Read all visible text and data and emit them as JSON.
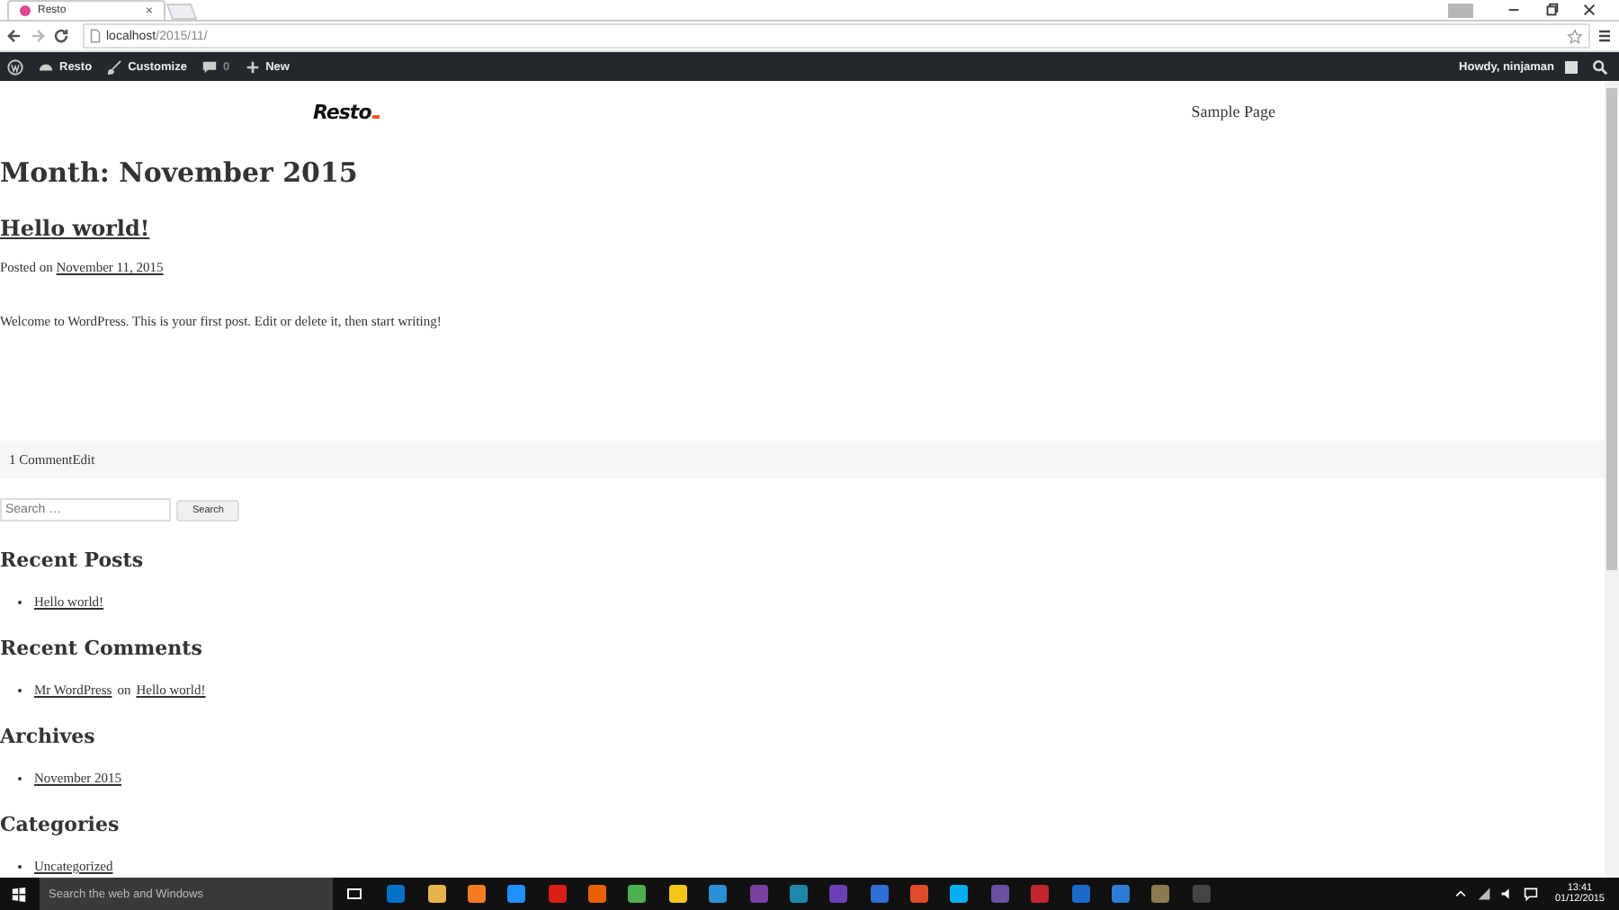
{
  "browser": {
    "tab_title": "Resto",
    "tab_close": "×",
    "url_host": "localhost",
    "url_path": "/2015/11/"
  },
  "admin_bar": {
    "site": "Resto",
    "customize": "Customize",
    "comments": "0",
    "new": "New",
    "greeting": "Howdy, ninjaman"
  },
  "site": {
    "logo": "Resto",
    "menu": [
      "Sample Page"
    ]
  },
  "archive_title": "Month: November 2015",
  "post": {
    "title": "Hello world!",
    "posted_on": "Posted on",
    "date": "November 11, 2015",
    "excerpt": "Welcome to WordPress. This is your first post. Edit or delete it, then start writing!",
    "comments_link": "1 Comment",
    "edit_link": "Edit"
  },
  "search": {
    "placeholder": "Search …",
    "button": "Search"
  },
  "widgets": [
    {
      "title": "Recent Posts",
      "items": [
        {
          "parts": [
            {
              "text": "Hello world!",
              "link": true
            }
          ]
        }
      ]
    },
    {
      "title": "Recent Comments",
      "items": [
        {
          "parts": [
            {
              "text": "Mr WordPress",
              "link": true
            },
            {
              "text": "on",
              "link": false
            },
            {
              "text": "Hello world!",
              "link": true
            }
          ]
        }
      ]
    },
    {
      "title": "Archives",
      "items": [
        {
          "parts": [
            {
              "text": "November 2015",
              "link": true
            }
          ]
        }
      ]
    },
    {
      "title": "Categories",
      "items": [
        {
          "parts": [
            {
              "text": "Uncategorized",
              "link": true
            }
          ]
        }
      ]
    }
  ],
  "taskbar": {
    "search_placeholder": "Search the web and Windows",
    "time": "13:41",
    "date": "01/12/2015"
  }
}
